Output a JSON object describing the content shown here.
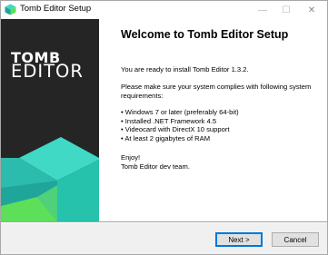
{
  "window": {
    "title": "Tomb Editor Setup",
    "minimize_glyph": "—",
    "maximize_glyph": "☐",
    "close_glyph": "✕"
  },
  "sidebar": {
    "logo_line1": "TOMB",
    "logo_line2": "EDITOR",
    "colors": {
      "background": "#252525",
      "cube_top": "#3fd9c6",
      "cube_left": "#1fa59a",
      "cube_right": "#26c2ac",
      "cube_bottom": "#5ddf5a"
    }
  },
  "main": {
    "heading": "Welcome to Tomb Editor Setup",
    "ready_text": "You are ready to install Tomb Editor 1.3.2.",
    "requirements_intro": "Please make sure your system complies with following system requirements:",
    "requirements": [
      "Windows 7 or later (preferably 64-bit)",
      "Installed .NET Framework 4.5",
      "Videocard with DirectX 10 support",
      "At least 2 gigabytes of RAM"
    ],
    "enjoy": "Enjoy!",
    "signature": "Tomb Editor dev team."
  },
  "buttons": {
    "next": "Next >",
    "cancel": "Cancel"
  },
  "icons": {
    "app": "tomb-editor-app-icon",
    "minimize": "minimize-icon",
    "maximize": "maximize-icon",
    "close": "close-icon"
  }
}
